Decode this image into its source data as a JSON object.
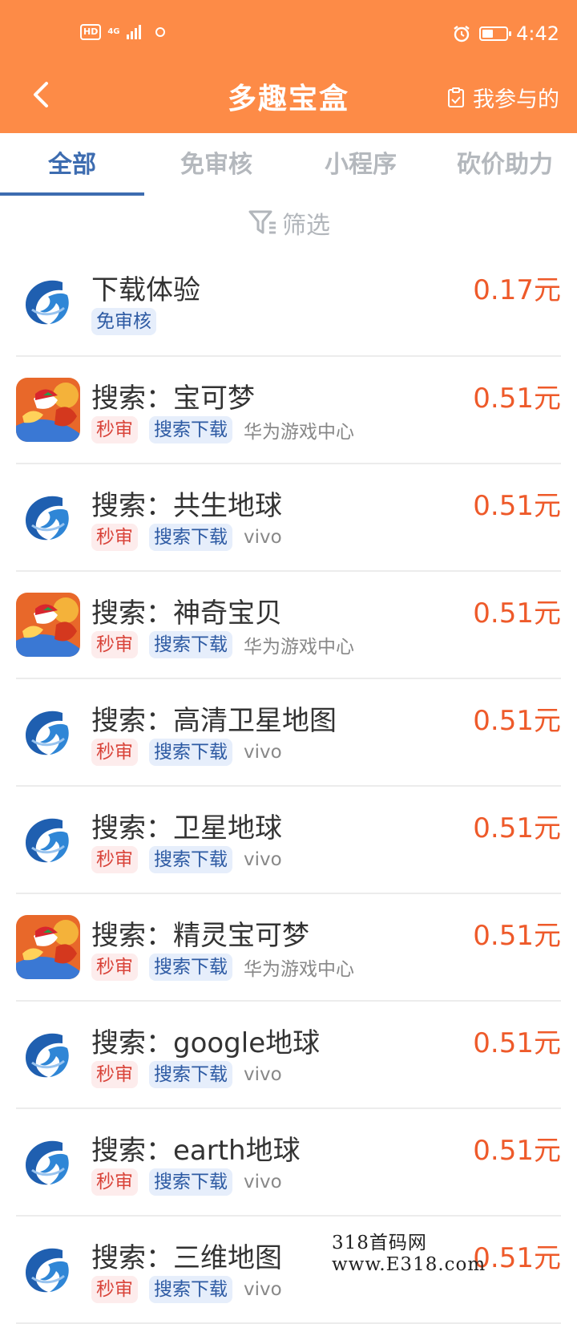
{
  "status": {
    "hd": "HD",
    "net": "4G",
    "time": "4:42",
    "battery_level": 0.45
  },
  "header": {
    "title": "多趣宝盒",
    "right_label": "我参与的"
  },
  "tabs": [
    "全部",
    "免审核",
    "小程序",
    "砍价助力"
  ],
  "active_tab": 0,
  "filter_label": "筛选",
  "items": [
    {
      "icon": "swirl-app-icon",
      "title": "下载体验",
      "price": "0.17元",
      "tags": [
        {
          "text": "免审核",
          "type": "blue"
        }
      ],
      "platform": ""
    },
    {
      "icon": "pokemon-game-icon",
      "title": "搜索：宝可梦",
      "price": "0.51元",
      "tags": [
        {
          "text": "秒审",
          "type": "red"
        },
        {
          "text": "搜索下载",
          "type": "blue"
        }
      ],
      "platform": "华为游戏中心"
    },
    {
      "icon": "swirl-app-icon",
      "title": "搜索：共生地球",
      "price": "0.51元",
      "tags": [
        {
          "text": "秒审",
          "type": "red"
        },
        {
          "text": "搜索下载",
          "type": "blue"
        }
      ],
      "platform": "vivo"
    },
    {
      "icon": "pokemon-game-icon",
      "title": "搜索：神奇宝贝",
      "price": "0.51元",
      "tags": [
        {
          "text": "秒审",
          "type": "red"
        },
        {
          "text": "搜索下载",
          "type": "blue"
        }
      ],
      "platform": "华为游戏中心"
    },
    {
      "icon": "swirl-app-icon",
      "title": "搜索：高清卫星地图",
      "price": "0.51元",
      "tags": [
        {
          "text": "秒审",
          "type": "red"
        },
        {
          "text": "搜索下载",
          "type": "blue"
        }
      ],
      "platform": "vivo"
    },
    {
      "icon": "swirl-app-icon",
      "title": "搜索：卫星地球",
      "price": "0.51元",
      "tags": [
        {
          "text": "秒审",
          "type": "red"
        },
        {
          "text": "搜索下载",
          "type": "blue"
        }
      ],
      "platform": "vivo"
    },
    {
      "icon": "pokemon-game-icon",
      "title": "搜索：精灵宝可梦",
      "price": "0.51元",
      "tags": [
        {
          "text": "秒审",
          "type": "red"
        },
        {
          "text": "搜索下载",
          "type": "blue"
        }
      ],
      "platform": "华为游戏中心"
    },
    {
      "icon": "swirl-app-icon",
      "title": "搜索：google地球",
      "price": "0.51元",
      "tags": [
        {
          "text": "秒审",
          "type": "red"
        },
        {
          "text": "搜索下载",
          "type": "blue"
        }
      ],
      "platform": "vivo"
    },
    {
      "icon": "swirl-app-icon",
      "title": "搜索：earth地球",
      "price": "0.51元",
      "tags": [
        {
          "text": "秒审",
          "type": "red"
        },
        {
          "text": "搜索下载",
          "type": "blue"
        }
      ],
      "platform": "vivo"
    },
    {
      "icon": "swirl-app-icon",
      "title": "搜索：三维地图",
      "price": "0.51元",
      "tags": [
        {
          "text": "秒审",
          "type": "red"
        },
        {
          "text": "搜索下载",
          "type": "blue"
        }
      ],
      "platform": "vivo"
    }
  ],
  "watermark": "318首码网 www.E318.com",
  "colors": {
    "header_bg": "#fd8b47",
    "accent_blue": "#3d6cb0",
    "price": "#ee5a2a",
    "tag_red": "#d9443a",
    "tag_blue": "#2d5aa3"
  }
}
